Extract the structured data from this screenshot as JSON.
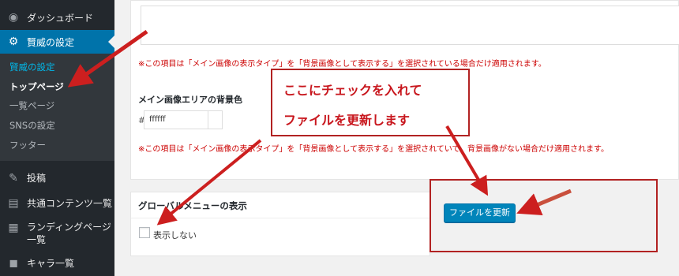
{
  "sidebar": {
    "dashboard": "ダッシュボード",
    "settings": "賢威の設定",
    "sub": [
      "賢威の設定",
      "トップページ",
      "一覧ページ",
      "SNSの設定",
      "フッター"
    ],
    "posts": "投稿",
    "common_content": "共通コンテンツ一覧",
    "landing_page_line1": "ランディングページ",
    "landing_page_line2": "一覧",
    "character": "キャラ一覧"
  },
  "main": {
    "note_top": "※この項目は「メイン画像の表示タイプ」を「背景画像として表示する」を選択されている場合だけ適用されます。",
    "bg_color_label": "メイン画像エリアの背景色",
    "hash": "#",
    "bg_color_value": "ffffff",
    "note_bottom": "※この項目は「メイン画像の表示タイプ」を「背景画像として表示する」を選択されていて、背景画像がない場合だけ適用されます。",
    "global_menu_title": "グローバルメニューの表示",
    "hide_label": "表示しない",
    "update_button": "ファイルを更新"
  },
  "annotation": {
    "line1": "ここにチェックを入れて",
    "line2": "ファイルを更新します"
  },
  "colors": {
    "sidebar": "#23282d",
    "active": "#0073aa",
    "button": "#0085ba",
    "annotation": "#b22222"
  }
}
